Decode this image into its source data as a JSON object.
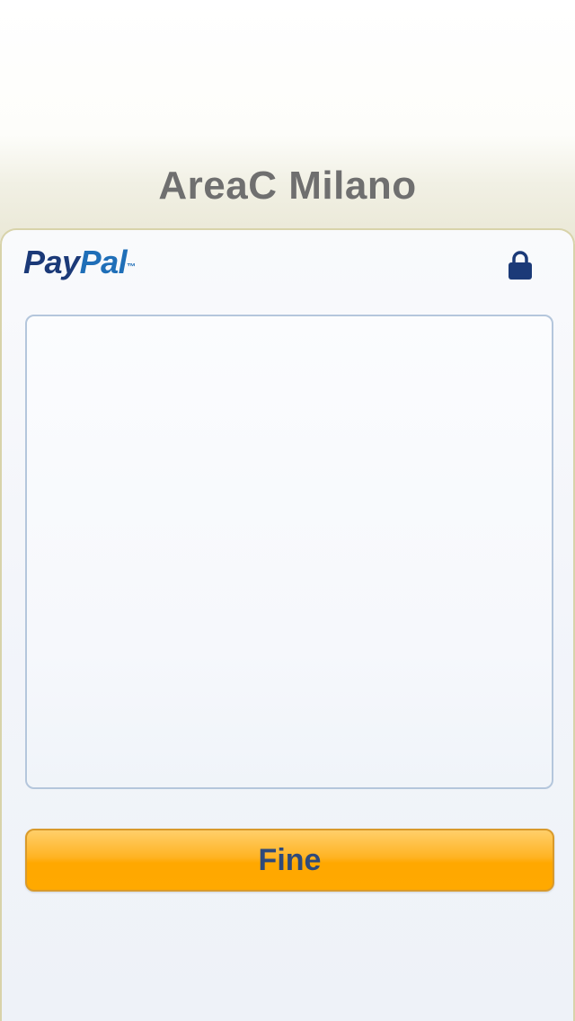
{
  "header": {
    "title": "AreaC Milano"
  },
  "paypal_sheet": {
    "logo": {
      "pay": "Pay",
      "pal": "Pal",
      "trademark": "™"
    },
    "lock_icon": "lock-icon",
    "done_button_label": "Fine"
  },
  "colors": {
    "button_orange": "#ffa800",
    "button_text": "#2f4a7a",
    "paypal_dark_blue": "#1b3a78",
    "paypal_light_blue": "#1f6fb8",
    "title_gray": "#6f6f6f",
    "sheet_border": "#d8d3aa"
  }
}
